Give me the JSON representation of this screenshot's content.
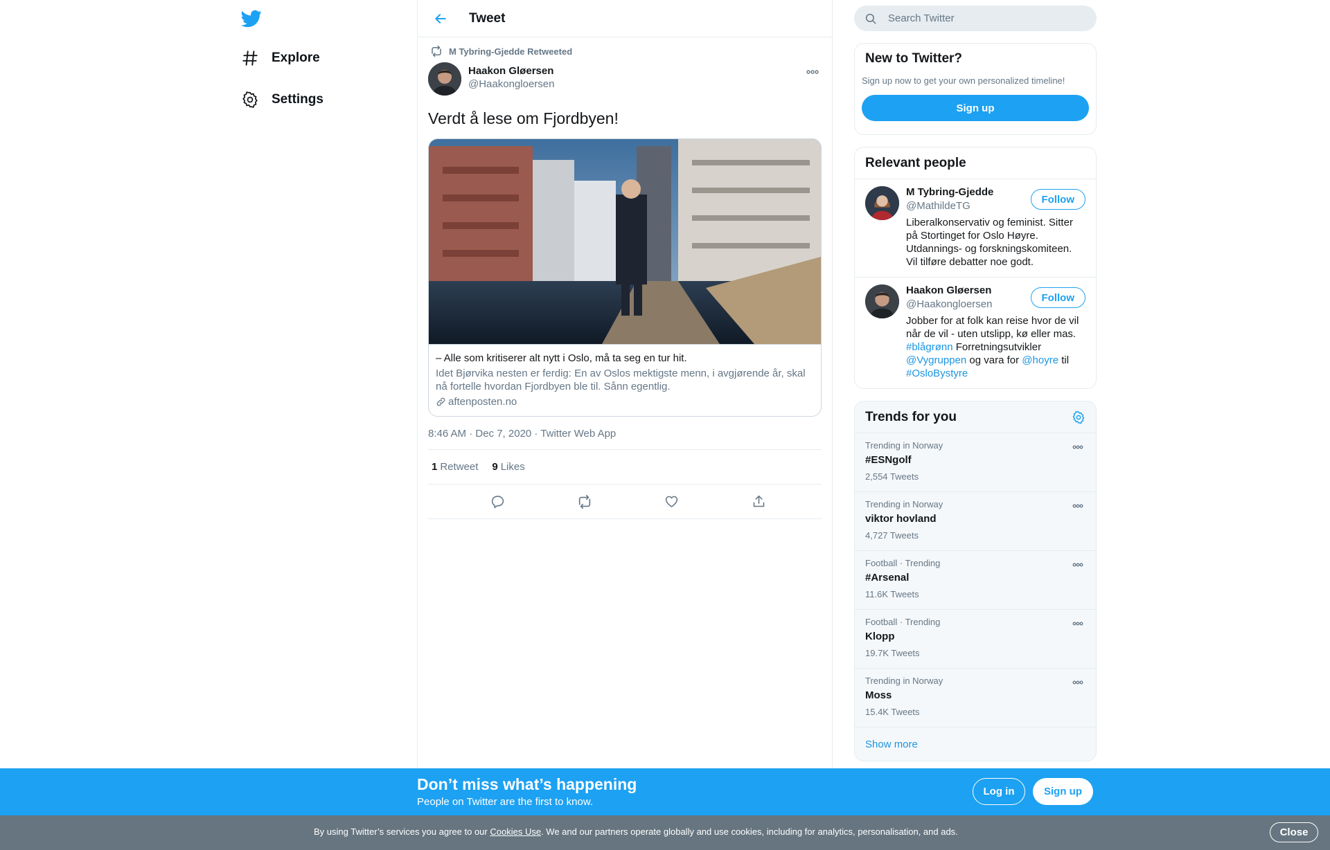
{
  "nav": {
    "items": [
      {
        "label": "Explore",
        "icon": "hashtag-icon"
      },
      {
        "label": "Settings",
        "icon": "gear-icon"
      }
    ]
  },
  "header": {
    "title": "Tweet"
  },
  "tweet": {
    "retweeted_by": "M Tybring-Gjedde Retweeted",
    "author_name": "Haakon Gløersen",
    "author_handle": "@Haakongloersen",
    "text": "Verdt å lese om Fjordbyen!",
    "card": {
      "title": "– Alle som kritiserer alt nytt i Oslo, må ta seg en tur hit.",
      "description": "Idet Bjørvika nesten er ferdig: En av Oslos mektigste menn, i avgjørende år, skal nå fortelle hvordan Fjordbyen ble til. Sånn egentlig.",
      "domain": "aftenposten.no"
    },
    "meta": "8:46 AM · Dec 7, 2020 · Twitter Web App",
    "retweet_count": "1",
    "retweet_label": "Retweet",
    "like_count": "9",
    "like_label": "Likes"
  },
  "search": {
    "placeholder": "Search Twitter"
  },
  "new_to_twitter": {
    "title": "New to Twitter?",
    "subtitle": "Sign up now to get your own personalized timeline!",
    "button": "Sign up"
  },
  "relevant": {
    "title": "Relevant people",
    "people": [
      {
        "name": "M Tybring-Gjedde",
        "handle": "@MathildeTG",
        "follow": "Follow",
        "bio": "Liberalkonservativ og feminist. Sitter på Stortinget for Oslo Høyre. Utdannings- og forskningskomiteen. Vil tilføre debatter noe godt."
      },
      {
        "name": "Haakon Gløersen",
        "handle": "@Haakongloersen",
        "follow": "Follow",
        "bio_parts": [
          "Jobber for at folk kan reise hvor de vil når de vil - uten utslipp, kø eller mas.",
          "#blågrønn",
          "Forretningsutvikler",
          "@Vygruppen",
          "og vara for",
          "@hoyre",
          "til",
          "#OsloBystyre"
        ]
      }
    ]
  },
  "trends": {
    "title": "Trends for you",
    "items": [
      {
        "context": "Trending in Norway",
        "name": "#ESNgolf",
        "count": "2,554 Tweets"
      },
      {
        "context": "Trending in Norway",
        "name": "viktor hovland",
        "count": "4,727 Tweets"
      },
      {
        "context": "Football · Trending",
        "name": "#Arsenal",
        "count": "11.6K Tweets"
      },
      {
        "context": "Football · Trending",
        "name": "Klopp",
        "count": "19.7K Tweets"
      },
      {
        "context": "Trending in Norway",
        "name": "Moss",
        "count": "15.4K Tweets"
      }
    ],
    "show_more": "Show more"
  },
  "banner": {
    "heading": "Don’t miss what’s happening",
    "subheading": "People on Twitter are the first to know.",
    "login": "Log in",
    "signup": "Sign up"
  },
  "cookie": {
    "prefix": "By using Twitter’s services you agree to our",
    "link": "Cookies Use",
    "suffix": ". We and our partners operate globally and use cookies, including for analytics, personalisation, and ads.",
    "close": "Close"
  },
  "colors": {
    "accent": "#1da1f2",
    "link": "#1b95e0",
    "muted": "#657786",
    "cookie_bar": "#66757f"
  }
}
